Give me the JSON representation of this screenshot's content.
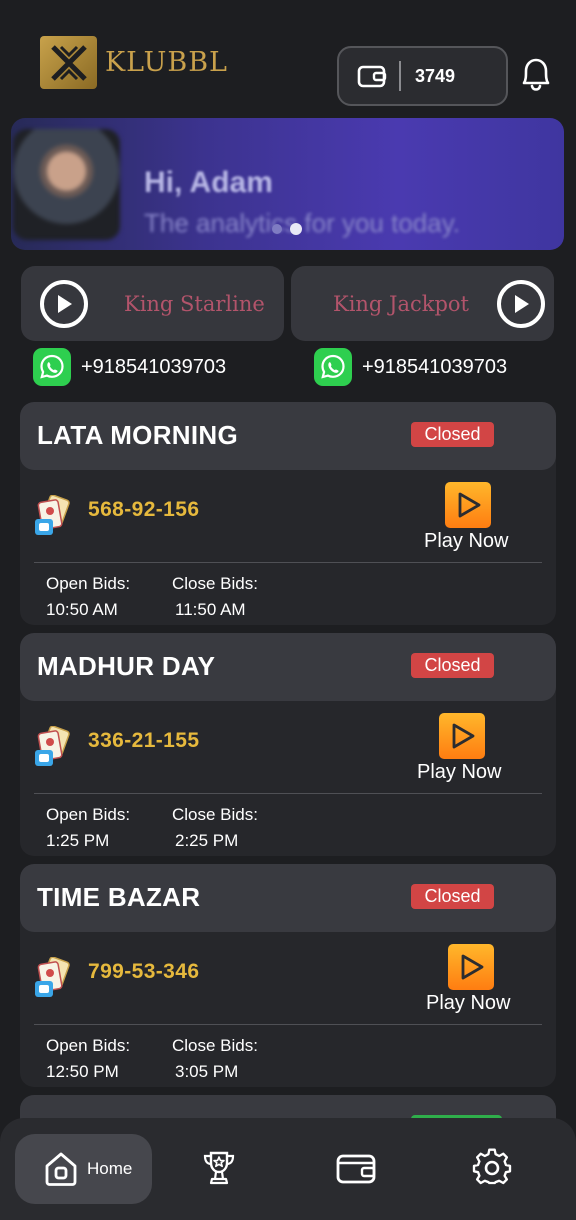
{
  "header": {
    "logo_text": "KLUBBL",
    "wallet_balance": "3749"
  },
  "banner": {
    "greeting": "Hi, Adam",
    "subtitle": "The analytics for you today.",
    "active_slide": 2,
    "slide_count": 2
  },
  "games": [
    {
      "label": "King Starline"
    },
    {
      "label": "King Jackpot"
    }
  ],
  "contacts": [
    {
      "phone": "+918541039703"
    },
    {
      "phone": "+918541039703"
    }
  ],
  "play_label": "Play Now",
  "open_bids_label": "Open Bids:",
  "close_bids_label": "Close Bids:",
  "markets": [
    {
      "name": "LATA MORNING",
      "status": "Closed",
      "result": "568-92-156",
      "open_time": "10:50 AM",
      "close_time": "11:50 AM"
    },
    {
      "name": "MADHUR DAY",
      "status": "Closed",
      "result": "336-21-155",
      "open_time": "1:25 PM",
      "close_time": "2:25 PM"
    },
    {
      "name": "TIME BAZAR",
      "status": "Closed",
      "result": "799-53-346",
      "open_time": "12:50 PM",
      "close_time": "3:05 PM"
    }
  ],
  "nav": {
    "home_label": "Home",
    "items": [
      "home-icon",
      "trophy-icon",
      "wallet-icon",
      "settings-icon"
    ]
  },
  "colors": {
    "accent_gold": "#e6b93d",
    "closed_red": "#d24545",
    "play_orange": "#ff9a1e",
    "banner_purple": "#4a3ab0",
    "game_label_pink": "#b2546b"
  }
}
